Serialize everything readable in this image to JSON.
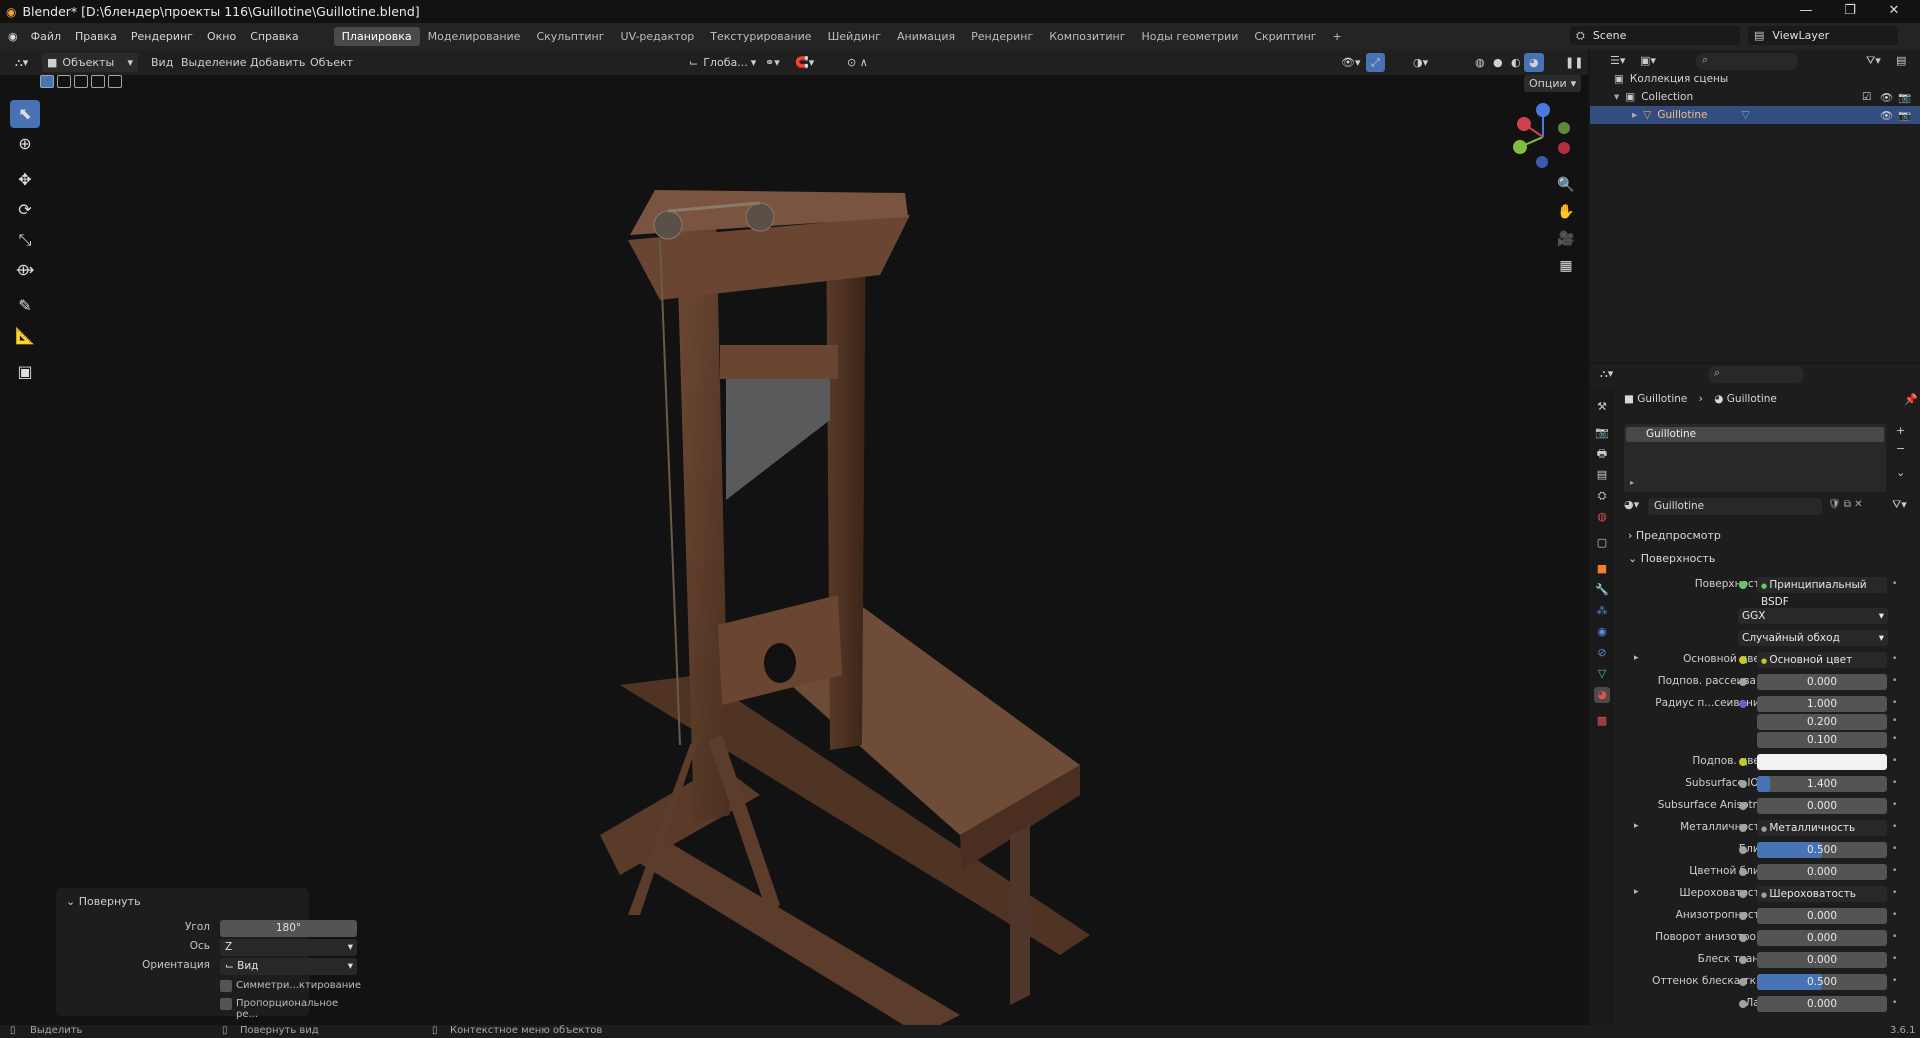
{
  "title": "Blender* [D:\\блендер\\проекты 116\\Guillotine\\Guillotine.blend]",
  "menus": [
    "Файл",
    "Правка",
    "Рендеринг",
    "Окно",
    "Справка"
  ],
  "workspaces": [
    "Планировка",
    "Моделирование",
    "Скульптинг",
    "UV-редактор",
    "Текстурирование",
    "Шейдинг",
    "Анимация",
    "Рендеринг",
    "Композитинг",
    "Ноды геометрии",
    "Скриптинг"
  ],
  "scene": "Scene",
  "view_layer": "ViewLayer",
  "viewport_header": {
    "mode": "Объекты",
    "menus": [
      "Вид",
      "Выделение",
      "Добавить",
      "Объект"
    ],
    "transform": "Глоба...",
    "options": "Опции"
  },
  "outliner": {
    "scene_collection": "Коллекция сцены",
    "collection": "Collection",
    "object": "Guillotine"
  },
  "props": {
    "breadcrumb": [
      "Guillotine",
      "Guillotine"
    ],
    "slot": "Guillotine",
    "material": "Guillotine",
    "preview": "Предпросмотр",
    "surface_section": "Поверхность",
    "rows": [
      {
        "label": "Поверхность",
        "value": "Принципиальный BSDF",
        "dot": "#63c763",
        "kind": "link"
      },
      {
        "label": "",
        "value": "GGX",
        "kind": "dropdown"
      },
      {
        "label": "",
        "value": "Случайный обход",
        "kind": "dropdown"
      },
      {
        "label": "Основной цвет",
        "value": "Основной цвет",
        "dot": "#c7c729",
        "kind": "link",
        "arrow": true
      },
      {
        "label": "Подпов. рассеива...",
        "value": "0.000",
        "dot": "#a1a1a1",
        "kind": "num"
      },
      {
        "label": "Радиус п...сеивания",
        "value": "1.000",
        "dot": "#6363c7",
        "kind": "num"
      },
      {
        "label": "",
        "value": "0.200",
        "kind": "num"
      },
      {
        "label": "",
        "value": "0.100",
        "kind": "num"
      },
      {
        "label": "Подпов. цвет",
        "value": "",
        "dot": "#c7c729",
        "kind": "color"
      },
      {
        "label": "Subsurface IOR",
        "value": "1.400",
        "dot": "#a1a1a1",
        "kind": "num",
        "fill": 0.1
      },
      {
        "label": "Subsurface Anisotr...",
        "value": "0.000",
        "dot": "#a1a1a1",
        "kind": "num"
      },
      {
        "label": "Металличность",
        "value": "Металличность",
        "dot": "#a1a1a1",
        "kind": "link",
        "arrow": true
      },
      {
        "label": "Блик",
        "value": "0.500",
        "dot": "#a1a1a1",
        "kind": "num",
        "fill": 0.5
      },
      {
        "label": "Цветной блик",
        "value": "0.000",
        "dot": "#a1a1a1",
        "kind": "num"
      },
      {
        "label": "Шероховатость",
        "value": "Шероховатость",
        "dot": "#a1a1a1",
        "kind": "link",
        "arrow": true
      },
      {
        "label": "Анизотропность",
        "value": "0.000",
        "dot": "#a1a1a1",
        "kind": "num"
      },
      {
        "label": "Поворот анизотро...",
        "value": "0.000",
        "dot": "#a1a1a1",
        "kind": "num"
      },
      {
        "label": "Блеск ткани",
        "value": "0.000",
        "dot": "#a1a1a1",
        "kind": "num"
      },
      {
        "label": "Оттенок блеска тк...",
        "value": "0.500",
        "dot": "#a1a1a1",
        "kind": "num",
        "fill": 0.5
      },
      {
        "label": "Лак",
        "value": "0.000",
        "dot": "#a1a1a1",
        "kind": "num"
      }
    ]
  },
  "rotate_panel": {
    "title": "Повернуть",
    "angle_label": "Угол",
    "angle": "180°",
    "axis_label": "Ось",
    "axis": "Z",
    "orient_label": "Ориентация",
    "orient": "Вид",
    "cb1": "Симметри...ктирование",
    "cb2": "Пропорциональное ре..."
  },
  "status": {
    "s1": "Выделить",
    "s2": "Повернуть вид",
    "s3": "Контекстное меню объектов",
    "version": "3.6.1"
  },
  "colors": {
    "accent": "#4772b3",
    "selected_row": "#334d80"
  }
}
